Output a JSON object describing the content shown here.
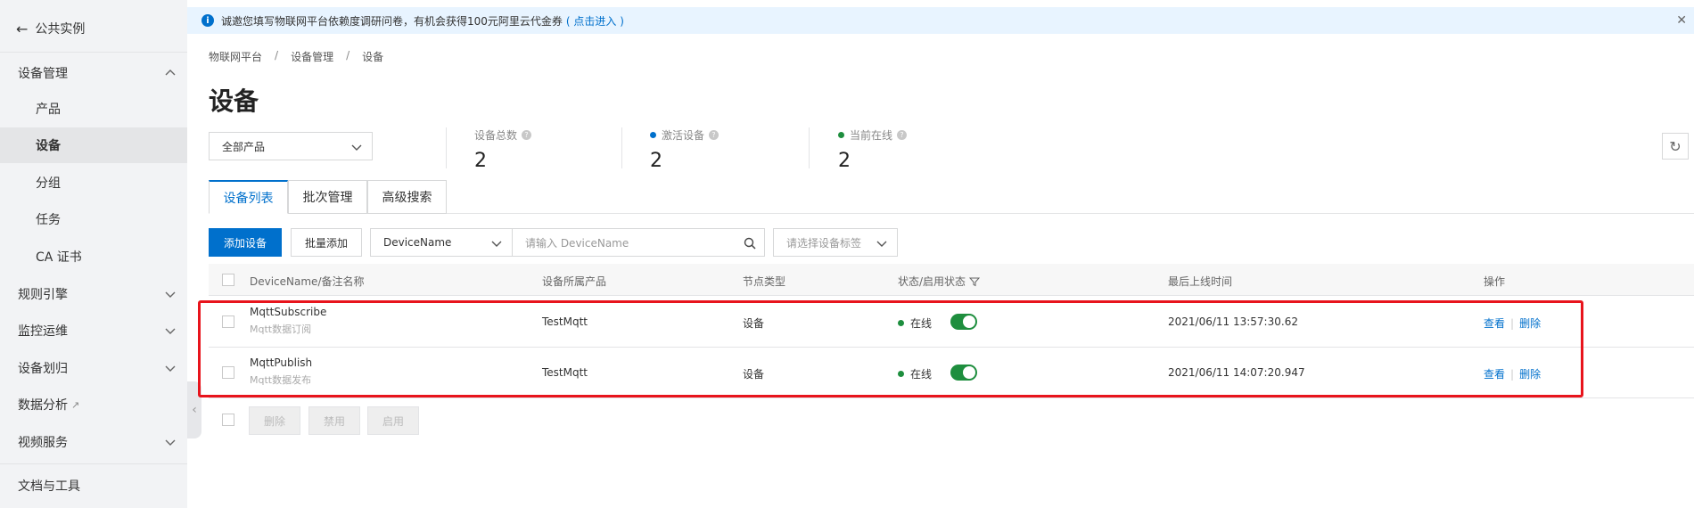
{
  "sidebar": {
    "back_label": "公共实例",
    "items": [
      {
        "label": "设备管理"
      },
      {
        "label": "产品"
      },
      {
        "label": "设备"
      },
      {
        "label": "分组"
      },
      {
        "label": "任务"
      },
      {
        "label": "CA 证书"
      },
      {
        "label": "规则引擎"
      },
      {
        "label": "监控运维"
      },
      {
        "label": "设备划归"
      },
      {
        "label": "数据分析"
      },
      {
        "label": "视频服务"
      },
      {
        "label": "文档与工具"
      }
    ]
  },
  "notice": {
    "text": "诚邀您填写物联网平台依赖度调研问卷，有机会获得100元阿里云代金券",
    "link": "( 点击进入 )"
  },
  "breadcrumb": [
    "物联网平台",
    "设备管理",
    "设备"
  ],
  "page_title": "设备",
  "product_select": "全部产品",
  "stats": [
    {
      "label": "设备总数",
      "value": "2"
    },
    {
      "label": "激活设备",
      "value": "2",
      "dot_color": "#0070cc"
    },
    {
      "label": "当前在线",
      "value": "2",
      "dot_color": "#1e8e3e"
    }
  ],
  "tabs": [
    {
      "label": "设备列表"
    },
    {
      "label": "批次管理"
    },
    {
      "label": "高级搜索"
    }
  ],
  "toolbar": {
    "add_label": "添加设备",
    "batch_label": "批量添加",
    "field_select": "DeviceName",
    "search_placeholder": "请输入 DeviceName",
    "tag_select": "请选择设备标签"
  },
  "table": {
    "headers": [
      "DeviceName/备注名称",
      "设备所属产品",
      "节点类型",
      "状态/启用状态",
      "最后上线时间",
      "操作"
    ],
    "rows": [
      {
        "name": "MqttSubscribe",
        "note": "Mqtt数据订阅",
        "product": "TestMqtt",
        "node_type": "设备",
        "status": "在线",
        "enabled": true,
        "last_online": "2021/06/11 13:57:30.62",
        "view": "查看",
        "delete": "删除"
      },
      {
        "name": "MqttPublish",
        "note": "Mqtt数据发布",
        "product": "TestMqtt",
        "node_type": "设备",
        "status": "在线",
        "enabled": true,
        "last_online": "2021/06/11 14:07:20.947",
        "view": "查看",
        "delete": "删除"
      }
    ]
  },
  "bulk_actions": {
    "delete": "删除",
    "disable": "禁用",
    "enable": "启用"
  },
  "colors": {
    "accent": "#0070cc",
    "online": "#1e8e3e",
    "highlight": "#e8141c",
    "brand": "#ff6a00"
  }
}
